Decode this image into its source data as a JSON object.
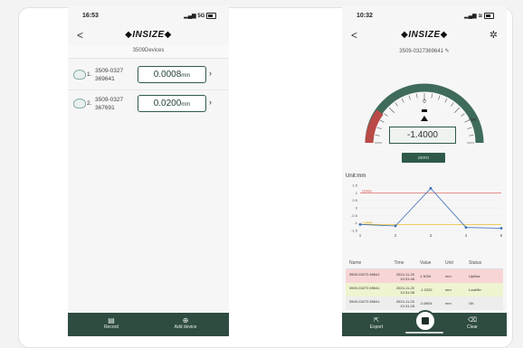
{
  "left_phone": {
    "status_time": "16:53",
    "status_signal": "5G",
    "back_label": "<",
    "brand": "INSIZE",
    "subtitle": "3509Devices",
    "devices": [
      {
        "index": "1.",
        "serial_a": "3509-0327",
        "serial_b": "369641",
        "value": "0.0008",
        "unit": "mm"
      },
      {
        "index": "2.",
        "serial_a": "3509-0327",
        "serial_b": "367691",
        "value": "0.0200",
        "unit": "mm"
      }
    ],
    "bottom_tabs": {
      "record": "Record",
      "add_device": "Add device"
    }
  },
  "right_phone": {
    "status_time": "10:32",
    "back_label": "<",
    "brand": "INSIZE",
    "serial": "3509-0327369641",
    "gauge": {
      "zero_mark": "0",
      "unit": "mm",
      "reading": "-1.4000",
      "level": 0.78
    },
    "zero_button": "ZERO",
    "chart_unit_label": "Unit:mm",
    "table": {
      "headers": [
        "Name",
        "Time",
        "Value",
        "Unit",
        "Status"
      ],
      "rows": [
        {
          "name": "3509-03273 69641",
          "time": "2024-11-20 10:31:48",
          "value": "1.3034",
          "unit": "mm",
          "status": "UpMax",
          "kind": "hi"
        },
        {
          "name": "3509-03273 69641",
          "time": "2024-11-20 10:31:38",
          "value": "-1.2032",
          "unit": "mm",
          "status": "LowMin",
          "kind": "lo"
        },
        {
          "name": "3509-03273 69641",
          "time": "2024-11-20 10:31:28",
          "value": "-0.8904",
          "unit": "mm",
          "status": "OK",
          "kind": "ok"
        }
      ]
    },
    "bottom_tabs": {
      "export": "Export",
      "clear": "Clear"
    }
  },
  "chart_data": {
    "type": "line",
    "ylabel": "",
    "x": [
      1,
      2,
      3,
      4,
      5
    ],
    "ticks_x": [
      "1",
      "2",
      "3",
      "4",
      "5"
    ],
    "ticks_y": [
      "1.5",
      "1",
      "0.5",
      "0",
      "-0.5",
      "-1",
      "-1.5"
    ],
    "ylim": [
      -1.5,
      1.5
    ],
    "series": [
      {
        "values": [
          -1.1,
          -1.2,
          1.3,
          -1.3,
          -1.35
        ]
      }
    ],
    "reference_lines": [
      {
        "name": "UpMax",
        "value": 1.0,
        "color": "#d9534f"
      },
      {
        "name": "LowMin",
        "value": -1.1,
        "color": "#e0b400"
      }
    ],
    "colors": {
      "line": "#3d6fb6",
      "marker": "#3d6fb6"
    }
  },
  "colors": {
    "primary": "#2f4c41",
    "accent_red": "#b94a48"
  }
}
